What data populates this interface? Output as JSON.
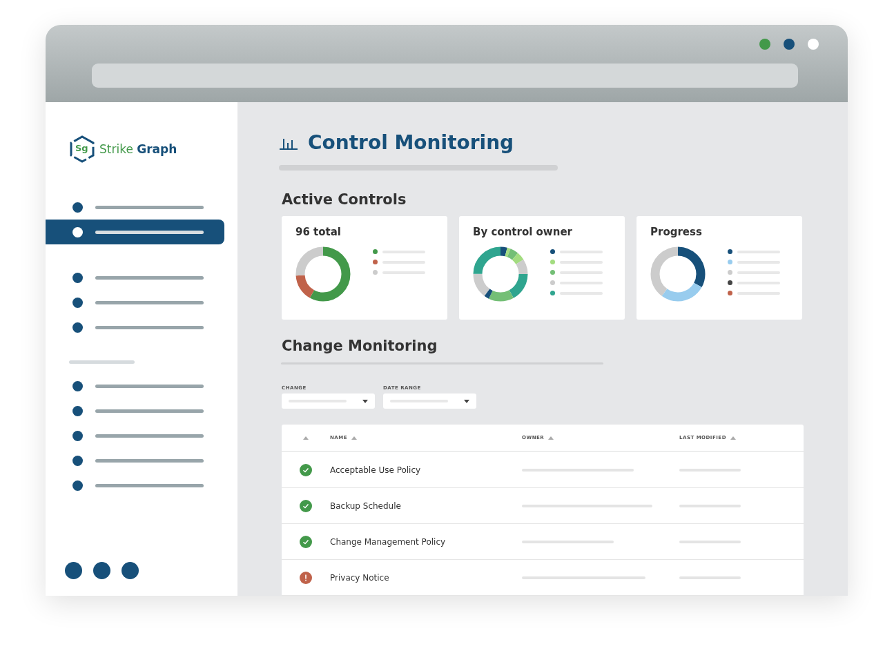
{
  "brand": {
    "prefix": "Strike",
    "name": "Graph",
    "badge": "Sg"
  },
  "sidebar": {
    "groups": [
      {
        "items": [
          {
            "selected": false
          },
          {
            "selected": true
          }
        ]
      },
      {
        "items": [
          {
            "selected": false
          },
          {
            "selected": false
          },
          {
            "selected": false
          }
        ]
      },
      {
        "items": [
          {
            "selected": false
          },
          {
            "selected": false
          },
          {
            "selected": false
          },
          {
            "selected": false
          },
          {
            "selected": false
          }
        ]
      }
    ]
  },
  "page_title": "Control Monitoring",
  "active_controls": {
    "heading": "Active Controls",
    "cards": [
      {
        "title": "96 total",
        "legend": [
          {
            "color": "#43994a"
          },
          {
            "color": "#c0624a"
          },
          {
            "color": "#cccccc"
          }
        ]
      },
      {
        "title": "By control owner",
        "legend": [
          {
            "color": "#17507a"
          },
          {
            "color": "#a3dc80"
          },
          {
            "color": "#74bf76"
          },
          {
            "color": "#cccccc"
          },
          {
            "color": "#2fa58f"
          }
        ]
      },
      {
        "title": "Progress",
        "legend": [
          {
            "color": "#17507a"
          },
          {
            "color": "#98ccee"
          },
          {
            "color": "#cccccc"
          },
          {
            "color": "#444444"
          },
          {
            "color": "#c0624a"
          }
        ]
      }
    ]
  },
  "change_monitoring": {
    "heading": "Change Monitoring",
    "filters": [
      {
        "label": "CHANGE"
      },
      {
        "label": "DATE RANGE"
      }
    ],
    "table": {
      "columns": [
        "NAME",
        "OWNER",
        "LAST MODIFIED"
      ],
      "rows": [
        {
          "kind": "ok",
          "name": "Acceptable Use Policy"
        },
        {
          "kind": "ok",
          "name": "Backup Schedule"
        },
        {
          "kind": "ok",
          "name": "Change Management Policy"
        },
        {
          "kind": "alert",
          "name": "Privacy Notice"
        }
      ]
    }
  }
}
